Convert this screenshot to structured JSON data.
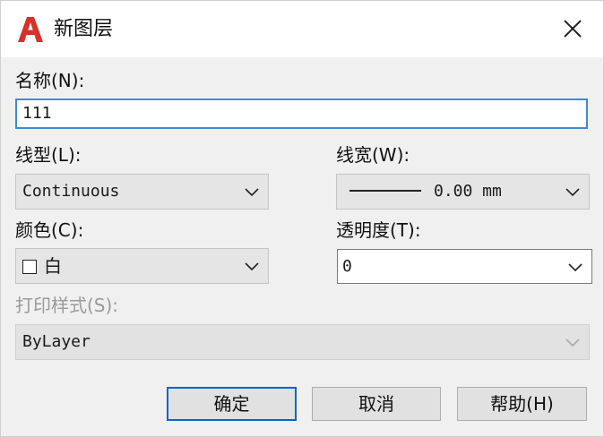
{
  "window": {
    "title": "新图层",
    "icon": "autocad-a-icon",
    "close_icon": "close-icon"
  },
  "name_field": {
    "label": "名称(N):",
    "value": "111"
  },
  "linetype": {
    "label": "线型(L):",
    "value": "Continuous"
  },
  "lineweight": {
    "label": "线宽(W):",
    "value": "0.00 mm"
  },
  "color": {
    "label": "颜色(C):",
    "value": "白",
    "swatch_color": "#ffffff"
  },
  "transparency": {
    "label": "透明度(T):",
    "value": "0"
  },
  "plot_style": {
    "label": "打印样式(S):",
    "value": "ByLayer",
    "disabled": true
  },
  "buttons": {
    "ok": "确定",
    "cancel": "取消",
    "help": "帮助(H)"
  },
  "colors": {
    "accent": "#0a64c8",
    "autocad_red": "#d6322b"
  }
}
